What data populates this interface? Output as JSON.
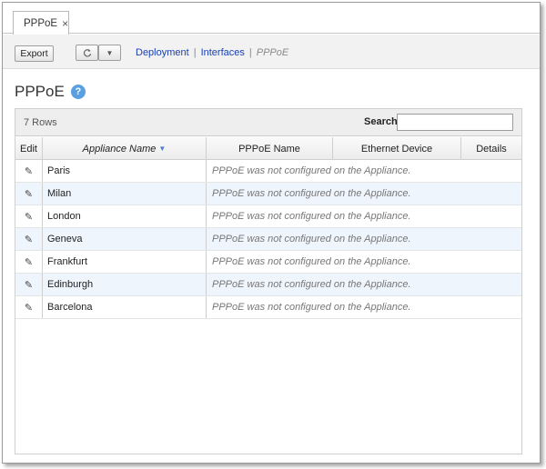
{
  "tab": {
    "label": "PPPoE",
    "close": "×"
  },
  "toolbar": {
    "export_label": "Export",
    "refresh_icon": "refresh-icon",
    "dropdown_icon": "caret-down-icon",
    "breadcrumb": [
      {
        "label": "Deployment",
        "link": true
      },
      {
        "label": "Interfaces",
        "link": true
      },
      {
        "label": "PPPoE",
        "link": false
      }
    ]
  },
  "page": {
    "title": "PPPoE",
    "help": "?"
  },
  "table": {
    "row_count": "7 Rows",
    "search_label": "Search",
    "search_value": "",
    "columns": [
      "Edit",
      "Appliance Name",
      "PPPoE Name",
      "Ethernet Device",
      "Details"
    ],
    "sorted_column": "Appliance Name",
    "rows": [
      {
        "name": "Paris",
        "message": "PPPoE was not configured on the Appliance."
      },
      {
        "name": "Milan",
        "message": "PPPoE was not configured on the Appliance."
      },
      {
        "name": "London",
        "message": "PPPoE was not configured on the Appliance."
      },
      {
        "name": "Geneva",
        "message": "PPPoE was not configured on the Appliance."
      },
      {
        "name": "Frankfurt",
        "message": "PPPoE was not configured on the Appliance."
      },
      {
        "name": "Edinburgh",
        "message": "PPPoE was not configured on the Appliance."
      },
      {
        "name": "Barcelona",
        "message": "PPPoE was not configured on the Appliance."
      }
    ]
  },
  "colors": {
    "link": "#1a3fb0",
    "help_icon": "#5aa0e0",
    "row_alt": "#eef5fd"
  }
}
